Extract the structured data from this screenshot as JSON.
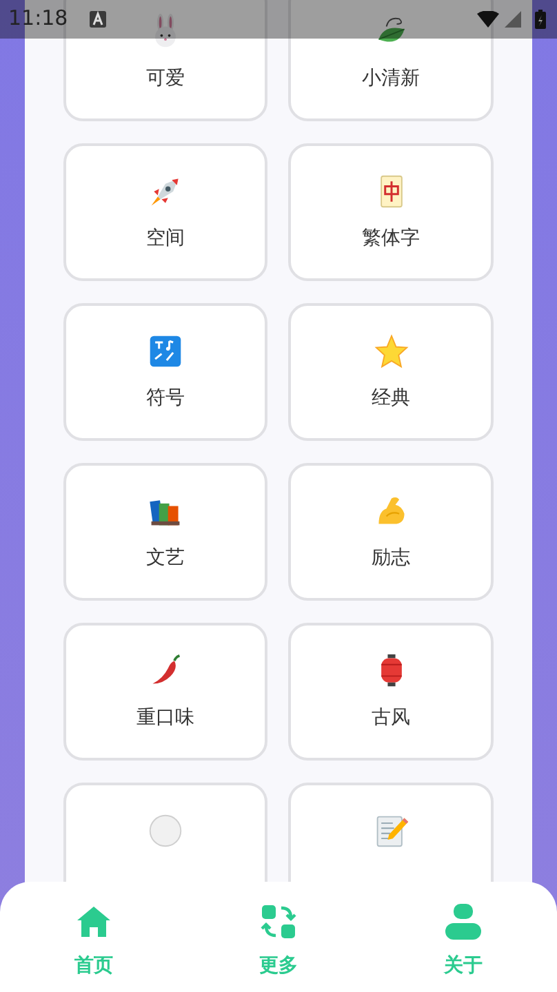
{
  "status_bar": {
    "time": "11:18"
  },
  "cards": [
    {
      "kind": "full",
      "label": "可爱"
    },
    {
      "kind": "full",
      "label": "小清新"
    },
    {
      "kind": "full",
      "label": "空间"
    },
    {
      "kind": "full",
      "label": "繁体字"
    },
    {
      "kind": "full",
      "label": "符号"
    },
    {
      "kind": "full",
      "label": "经典"
    },
    {
      "kind": "full",
      "label": "文艺"
    },
    {
      "kind": "full",
      "label": "励志"
    },
    {
      "kind": "full",
      "label": "重口味"
    },
    {
      "kind": "full",
      "label": "古风"
    },
    {
      "kind": "partial"
    },
    {
      "kind": "partial"
    }
  ],
  "nav": [
    {
      "label": "首页"
    },
    {
      "label": "更多"
    },
    {
      "label": "关于"
    }
  ]
}
